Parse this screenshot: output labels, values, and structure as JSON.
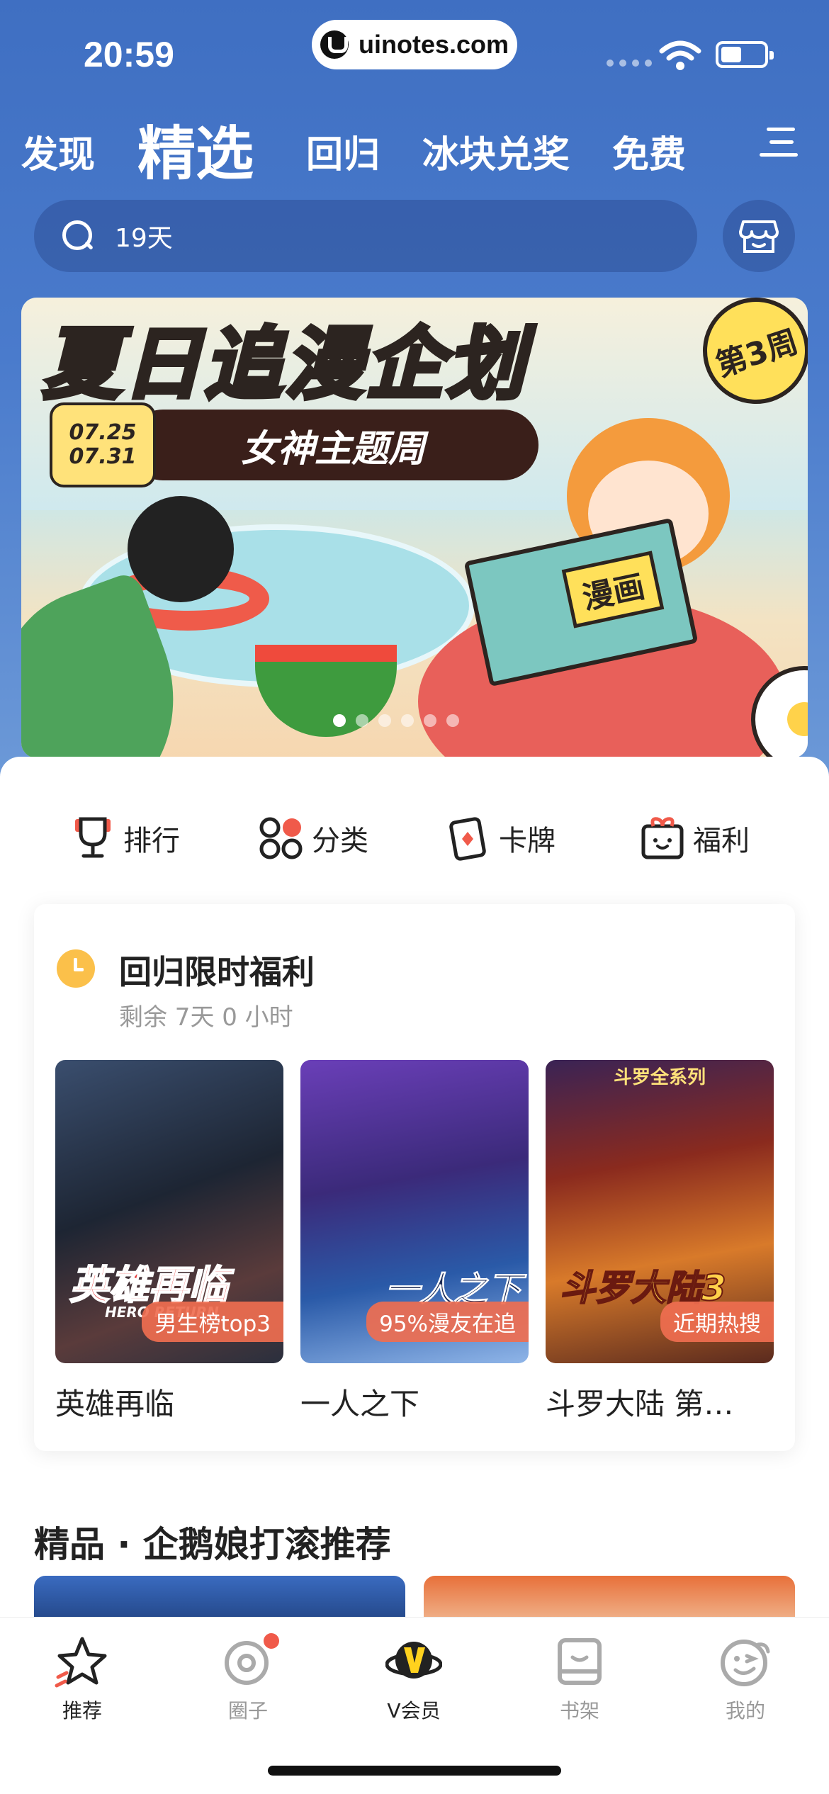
{
  "status_bar": {
    "time": "20:59",
    "url": "uinotes.com"
  },
  "nav": {
    "tabs": [
      {
        "label": "发现",
        "active": false
      },
      {
        "label": "精选",
        "active": true
      },
      {
        "label": "回归",
        "active": false
      },
      {
        "label": "冰块兑奖",
        "active": false
      },
      {
        "label": "免费",
        "active": false
      }
    ],
    "menu_icon": "menu-icon"
  },
  "search": {
    "text": "19天",
    "icon": "search-icon",
    "shop_icon": "shop-icon"
  },
  "banner": {
    "title": "夏日追漫企划",
    "week_badge": "第3周",
    "date_start": "07.25",
    "date_end": "07.31",
    "theme": "女神主题周",
    "book_label": "漫画",
    "page_count": 6,
    "active_page": 1
  },
  "quick_actions": [
    {
      "label": "排行",
      "icon": "trophy-icon"
    },
    {
      "label": "分类",
      "icon": "category-icon"
    },
    {
      "label": "卡牌",
      "icon": "card-icon"
    },
    {
      "label": "福利",
      "icon": "gift-icon"
    }
  ],
  "welfare": {
    "title": "回归限时福利",
    "remaining": "剩余 7天 0 小时",
    "comics": [
      {
        "title": "英雄再临",
        "tag": "男生榜top3",
        "cover_text": "英雄再临",
        "cover_subtitle": "HERO RETURN"
      },
      {
        "title": "一人之下",
        "tag": "95%漫友在追",
        "cover_text": "一人之下"
      },
      {
        "title": "斗罗大陆 第…",
        "tag": "近期热搜",
        "cover_header": "斗罗全系列",
        "cover_text": "斗罗大陆3"
      }
    ]
  },
  "section": {
    "title": "精品 · 企鹅娘打滚推荐"
  },
  "tab_bar": {
    "tabs": [
      {
        "label": "推荐",
        "icon": "star-icon",
        "active": true
      },
      {
        "label": "圈子",
        "icon": "circle-icon",
        "badge": true
      },
      {
        "label": "V会员",
        "icon": "vip-icon"
      },
      {
        "label": "书架",
        "icon": "bookshelf-icon"
      },
      {
        "label": "我的",
        "icon": "profile-icon"
      }
    ]
  },
  "colors": {
    "header_blue": "#4a7bcc",
    "accent_orange": "#ef6e50",
    "badge_red": "#f05a4a",
    "vip_yellow": "#ffd21e"
  }
}
